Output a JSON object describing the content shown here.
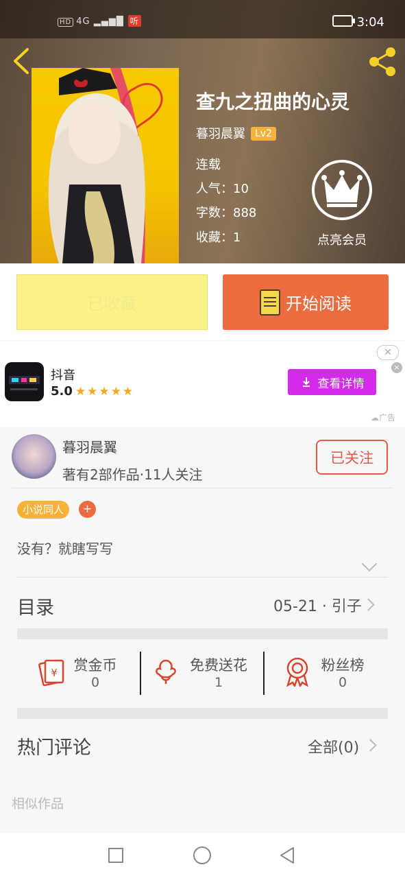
{
  "status_bar": {
    "left_indicators": "HD 4G",
    "ting_badge": "听",
    "time": "3:04"
  },
  "book": {
    "title": "查九之扭曲的心灵",
    "author": "暮羽晨翼",
    "level": "Lv2",
    "state": "连载",
    "popularity_label": "人气：10",
    "word_count_label": "字数：888",
    "favorites_label": "收藏：1",
    "vip_label": "点亮会员"
  },
  "actions": {
    "favorited_label": "已收藏",
    "read_label": "开始阅读"
  },
  "ad": {
    "app_name": "抖音",
    "rating": "5.0",
    "stars": "★★★★★",
    "details_label": "查看详情",
    "ad_tag": "广告",
    "close_symbol": "✕",
    "dismiss_symbol": "×"
  },
  "author_card": {
    "name": "暮羽晨翼",
    "stats": "著有2部作品·11人关注",
    "follow_label": "已关注",
    "tag": "小说同人",
    "tag_add": "+",
    "intro": "没有？就瞎写写"
  },
  "toc": {
    "label": "目录",
    "latest": "05-21 · 引子"
  },
  "stats": [
    {
      "title": "赏金币",
      "value": "0",
      "icon": "red-envelope-icon"
    },
    {
      "title": "免费送花",
      "value": "1",
      "icon": "flower-icon"
    },
    {
      "title": "粉丝榜",
      "value": "0",
      "icon": "medal-icon"
    }
  ],
  "comments": {
    "label": "热门评论",
    "all_label": "全部(0)"
  },
  "similar_label": "相似作品",
  "colors": {
    "accent": "#ea6c3f",
    "favorite_bg": "#fbf389",
    "ad_button": "#d42bea",
    "tag": "#f7b23a"
  }
}
